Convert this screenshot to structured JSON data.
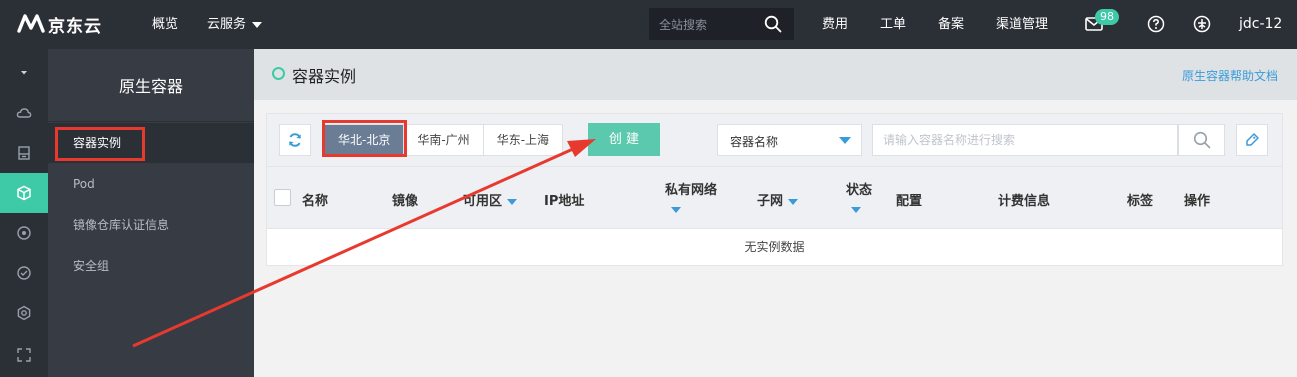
{
  "topbar": {
    "brand": "京东云",
    "nav": [
      {
        "label": "概览"
      },
      {
        "label": "云服务"
      }
    ],
    "search_placeholder": "全站搜索",
    "links": [
      {
        "label": "费用"
      },
      {
        "label": "工单"
      },
      {
        "label": "备案"
      },
      {
        "label": "渠道管理"
      }
    ],
    "message_badge": "98",
    "user": "jdc-12"
  },
  "rail": {
    "icons": [
      "collapse-icon",
      "cloud-icon",
      "storage-icon",
      "container-icon",
      "network-icon",
      "monitor-icon",
      "settings-icon",
      "expand-icon"
    ],
    "active_index": 3,
    "accent_color": "#3ec9a7"
  },
  "sidebar": {
    "title": "原生容器",
    "items": [
      {
        "label": "容器实例",
        "active": true
      },
      {
        "label": "Pod"
      },
      {
        "label": "镜像仓库认证信息"
      },
      {
        "label": "安全组"
      }
    ]
  },
  "main": {
    "title": "容器实例",
    "help_link": "原生容器帮助文档",
    "regions": [
      {
        "label": "华北-北京",
        "active": true
      },
      {
        "label": "华南-广州"
      },
      {
        "label": "华东-上海"
      }
    ],
    "create_label": "创 建",
    "filter_select": "容器名称",
    "search_placeholder": "请输入容器名称进行搜索",
    "columns": [
      {
        "label": "名称"
      },
      {
        "label": "镜像"
      },
      {
        "label": "可用区"
      },
      {
        "label": "IP地址"
      },
      {
        "label": "私有网络"
      },
      {
        "label": "子网"
      },
      {
        "label": "状态"
      },
      {
        "label": "配置"
      },
      {
        "label": "计费信息"
      },
      {
        "label": "标签"
      },
      {
        "label": "操作"
      }
    ],
    "empty_text": "无实例数据"
  },
  "annotation_color": "#e8392f"
}
